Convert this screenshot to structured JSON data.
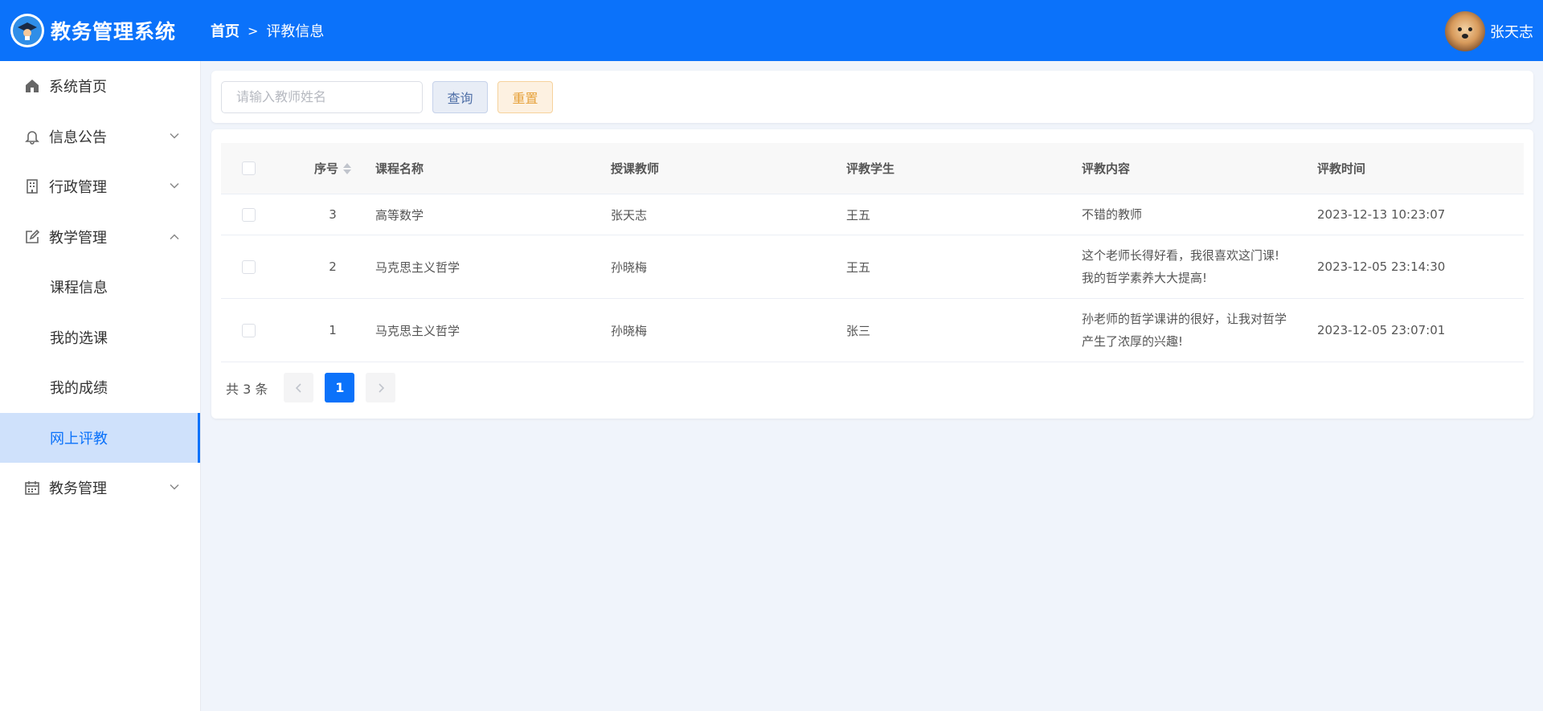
{
  "header": {
    "app_title": "教务管理系统",
    "breadcrumb": {
      "home": "首页",
      "current": "评教信息"
    },
    "user_name": "张天志",
    "brand_color": "#0b72fa"
  },
  "sidebar": {
    "items": [
      {
        "label": "系统首页",
        "icon": "home-icon"
      },
      {
        "label": "信息公告",
        "icon": "bell-icon"
      },
      {
        "label": "行政管理",
        "icon": "building-icon"
      },
      {
        "label": "教学管理",
        "icon": "edit-icon"
      }
    ],
    "teaching_sub": [
      "课程信息",
      "我的选课",
      "我的成绩",
      "网上评教"
    ],
    "last_item": {
      "label": "教务管理",
      "icon": "calendar-icon"
    }
  },
  "search": {
    "placeholder": "请输入教师姓名",
    "query_label": "查询",
    "reset_label": "重置"
  },
  "table": {
    "columns": [
      "序号",
      "课程名称",
      "授课教师",
      "评教学生",
      "评教内容",
      "评教时间"
    ],
    "rows": [
      {
        "id": "3",
        "course": "高等数学",
        "teacher": "张天志",
        "student": "王五",
        "content_line1": "不错的教师",
        "content_line2": "",
        "time": "2023-12-13 10:23:07"
      },
      {
        "id": "2",
        "course": "马克思主义哲学",
        "teacher": "孙晓梅",
        "student": "王五",
        "content_line1": "这个老师长得好看，我很喜欢这门课!",
        "content_line2": "我的哲学素养大大提高!",
        "time": "2023-12-05 23:14:30"
      },
      {
        "id": "1",
        "course": "马克思主义哲学",
        "teacher": "孙晓梅",
        "student": "张三",
        "content_line1": "孙老师的哲学课讲的很好，让我对哲学",
        "content_line2": "产生了浓厚的兴趣!",
        "time": "2023-12-05 23:07:01"
      }
    ]
  },
  "pagination": {
    "total": "共 3 条",
    "current_page": "1"
  }
}
